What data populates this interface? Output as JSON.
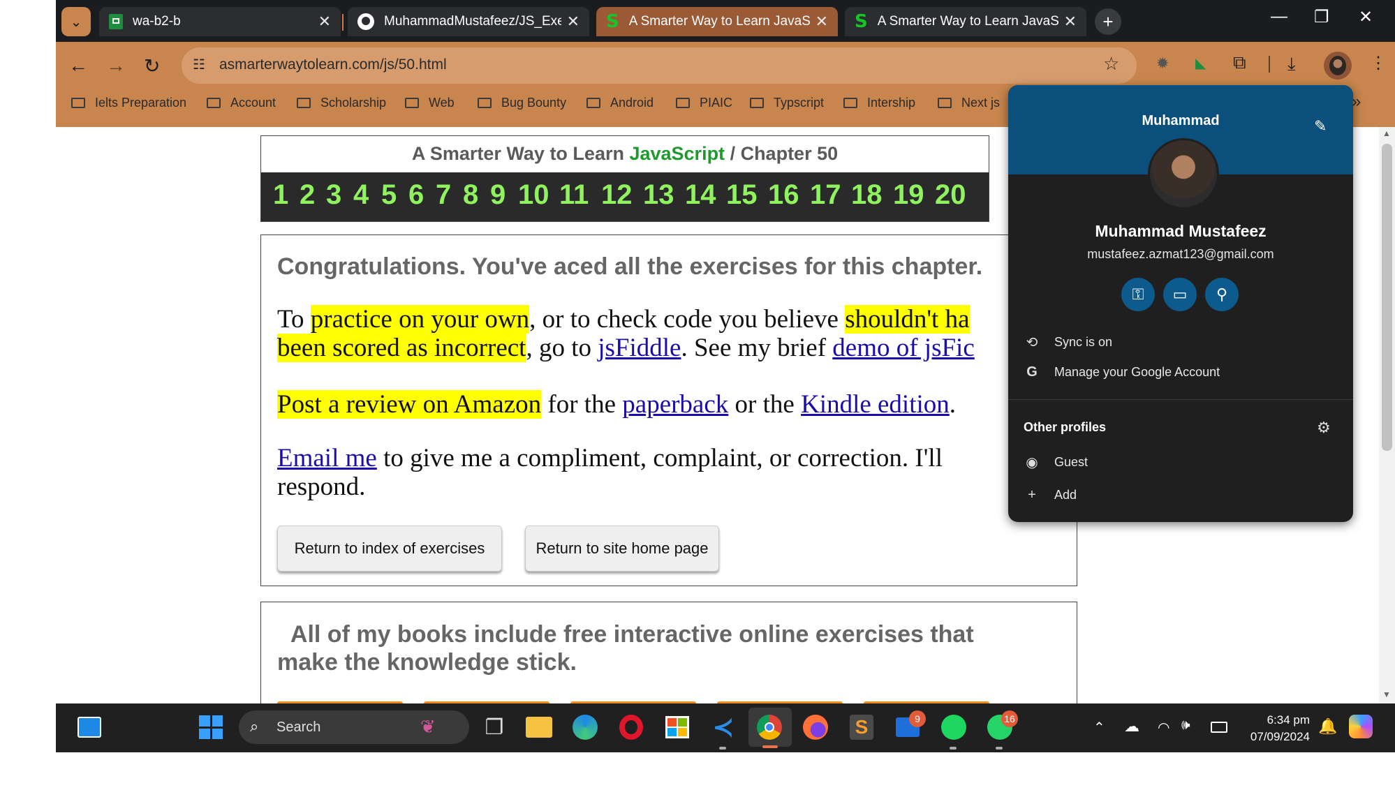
{
  "browser": {
    "tabs": [
      {
        "title": "wa-b2-b",
        "favicon": "google-sheets-icon"
      },
      {
        "title": "MuhammadMustafeez/JS_Exerc",
        "favicon": "github-icon"
      },
      {
        "title": "A Smarter Way to Learn JavaScr",
        "favicon": "s-icon",
        "active": true
      },
      {
        "title": "A Smarter Way to Learn JavaScr",
        "favicon": "s-icon"
      }
    ],
    "url": "asmarterwaytolearn.com/js/50.html",
    "bookmarks": [
      "Ielts Preparation",
      "Account",
      "Scholarship",
      "Web",
      "Bug Bounty",
      "Android",
      "PIAIC",
      "Typscript",
      "Intership",
      "Next js"
    ],
    "more_bookmarks": "»"
  },
  "page": {
    "header": {
      "prefix": "A Smarter Way to Learn ",
      "js": "JavaScript",
      "suffix": " /  Chapter 50"
    },
    "chapters": [
      "1",
      "2",
      "3",
      "4",
      "5",
      "6",
      "7",
      "8",
      "9",
      "10",
      "11",
      "12",
      "13",
      "14",
      "15",
      "16",
      "17",
      "18",
      "19",
      "20"
    ],
    "congrats": "Congratulations. You've aced all the exercises for this chapter.",
    "p1": {
      "t1": "To ",
      "h1": "practice on your own",
      "t2": ", or to check code you believe ",
      "h2": "shouldn't ha",
      "h3": "been scored as incorrect",
      "t3": ", go to ",
      "l1": "jsFiddle",
      "t4": ". See my brief ",
      "l2": "demo of jsFic"
    },
    "p2": {
      "h1": "Post a review on Amazon",
      "t1": " for the ",
      "l1": "paperback",
      "t2": " or the ",
      "l2": "Kindle edition",
      "t3": "."
    },
    "p3": {
      "l1": "Email me",
      "t1": " to give me a compliment, complaint, or correction. I'll",
      "t2": "respond."
    },
    "buttons": {
      "index": "Return to index of exercises",
      "home": "Return to site home page"
    },
    "books": {
      "line1": "All of my books include free interactive online exercises that",
      "line2": "make the knowledge stick."
    }
  },
  "profile": {
    "first_name": "Muhammad",
    "full_name": "Muhammad Mustafeez",
    "email": "mustafeez.azmat123@gmail.com",
    "sync": "Sync is on",
    "manage": "Manage your Google Account",
    "other_profiles": "Other profiles",
    "guest": "Guest",
    "add": "Add"
  },
  "taskbar": {
    "search_placeholder": "Search",
    "mail_badge": "9",
    "whatsapp_badge": "16",
    "time": "6:34 pm",
    "date": "07/09/2024"
  },
  "colors": {
    "accent": "#c8854d",
    "profile_header": "#0b4f7c",
    "chapter_numbers": "#8ff25e",
    "highlight": "#ffff00"
  }
}
